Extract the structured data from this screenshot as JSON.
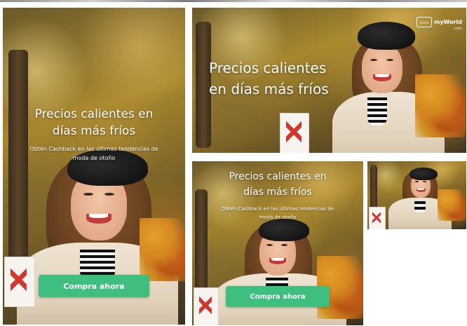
{
  "ad_copy": {
    "headline_line1": "Precios calientes en",
    "headline_line2": "días más fríos",
    "headline_wide_line1": "Precios calientes",
    "headline_wide_line2": "en días más fríos",
    "subline_line1": "Obtén Cashback en las últimas tendencias de",
    "subline_line2": "moda de otoño",
    "cta_label": "Compra ahora"
  },
  "brand": {
    "logo_text": "myWorld",
    "logo_sub": ".com"
  },
  "colors": {
    "cta_green": "#3fbf7f",
    "text_white": "#ffffff",
    "background": "#ffffff"
  }
}
